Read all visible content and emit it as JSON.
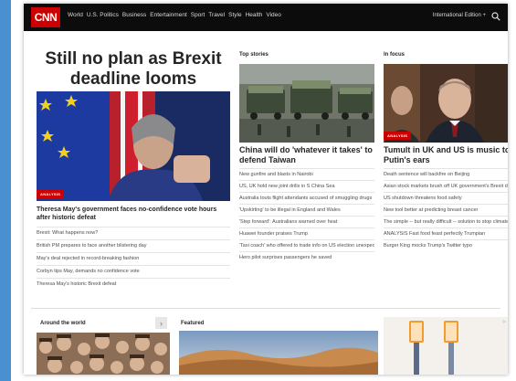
{
  "nav": {
    "logo": "CNN",
    "links": [
      "World",
      "U.S. Politics",
      "Business",
      "Entertainment",
      "Sport",
      "Travel",
      "Style",
      "Health",
      "Video"
    ],
    "edition": "International Edition +"
  },
  "hero": {
    "headline": "Still no plan as Brexit deadline looms",
    "badge": "ANALYSIS",
    "caption": "Theresa May's government faces no-confidence vote hours after historic defeat",
    "items": [
      "Brexit: What happens now?",
      "British PM prepares to face another blistering day",
      "May's deal rejected in record-breaking fashion",
      "Corbyn tips May, demands no confidence vote",
      "Theresa May's historic Brexit defeat"
    ]
  },
  "top_stories": {
    "header": "Top stories",
    "title": "China will do 'whatever it takes' to defend Taiwan",
    "items": [
      "New gunfire and blasts in Nairobi",
      "US, UK hold new joint drills in S China Sea",
      "Australia touts flight attendants accused of smuggling drugs",
      "'Upskirting' to be illegal in England and Wales",
      "'Step forward': Australians warned over heat",
      "Huawei founder praises Trump",
      "'Taxi coach' who offered to trade info on US election unexpectedly pleads guilty",
      "Hero pilot surprises passengers he saved"
    ]
  },
  "in_focus": {
    "header": "In focus",
    "badge": "ANALYSIS",
    "title": "Tumult in UK and US is music to Putin's ears",
    "items": [
      "Death sentence will backfire on Beijing",
      "Asian stock markets brush off UK government's Brexit defeat",
      "US shutdown threatens food safety",
      "New tool better at predicting breast cancer",
      "The simple -- but really difficult -- solution to stop climate change",
      "ANALYSIS Fast food feast perfectly Trumpian",
      "Burger King mocks Trump's Twitter typo"
    ]
  },
  "bottom": {
    "around_header": "Around the world",
    "around_arrow": "›",
    "featured_header": "Featured",
    "ad_mark": "▷"
  },
  "colors": {
    "brand_red": "#cc0000",
    "nav_bg": "#0c0c0c",
    "accent_blue": "#4a8fd0"
  }
}
